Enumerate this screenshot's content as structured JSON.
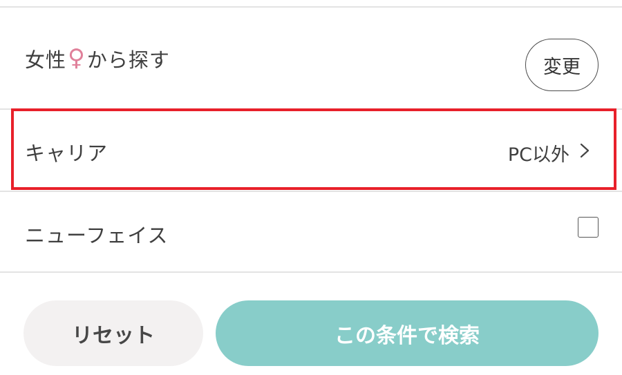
{
  "gender_row": {
    "label_before": "女性",
    "symbol": "♀",
    "label_after": "から探す",
    "change_label": "変更"
  },
  "carrier_row": {
    "label": "キャリア",
    "value": "PC以外",
    "chevron_icon": "chevron-right-icon"
  },
  "newface_row": {
    "label": "ニューフェイス",
    "checked": false
  },
  "actions": {
    "reset_label": "リセット",
    "search_label": "この条件で検索"
  },
  "colors": {
    "female_symbol": "#e0809a",
    "highlight_border": "#e8202a",
    "search_button_bg": "#88cdc9",
    "reset_button_bg": "#f3f1f1"
  }
}
